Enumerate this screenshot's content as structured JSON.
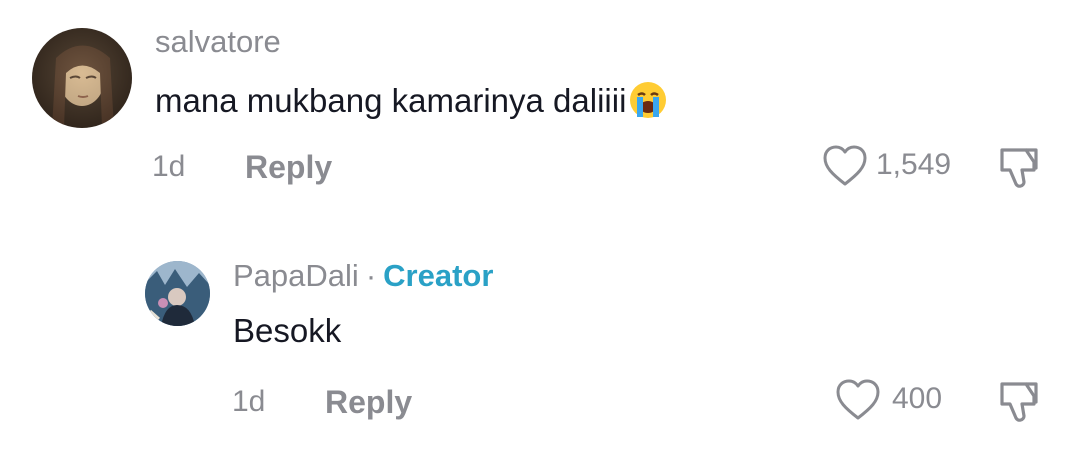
{
  "comments": [
    {
      "username": "salvatore",
      "text": "mana mukbang kamarinya daliiii",
      "emoji_icon": "loudly-crying-face-icon",
      "time": "1d",
      "reply_label": "Reply",
      "likes": "1,549"
    }
  ],
  "reply": {
    "username": "PapaDali",
    "separator": "·",
    "badge": "Creator",
    "text": "Besokk",
    "time": "1d",
    "reply_label": "Reply",
    "likes": "400"
  },
  "colors": {
    "muted": "#8a8b91",
    "text": "#161823",
    "creator": "#2aa1c6"
  }
}
